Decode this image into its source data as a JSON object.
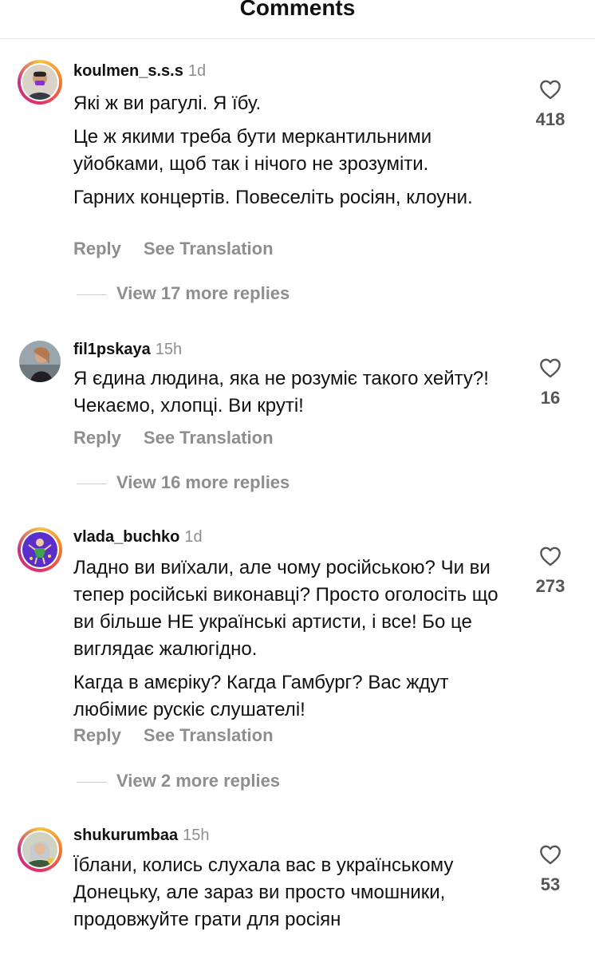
{
  "header": {
    "title": "Comments"
  },
  "comments": [
    {
      "username": "koulmen_s.s.s",
      "time": "1d",
      "paragraphs": [
        "Які ж ви рагулі. Я їбу.",
        "Це ж якими треба бути меркантильними уйобками, щоб так і нічого не зрозуміти.",
        "Гарних концертів. Повеселіть росіян, клоуни."
      ],
      "likes": "418",
      "reply": "Reply",
      "translate": "See Translation",
      "view_replies": "View 17 more replies"
    },
    {
      "username": "fil1pskaya",
      "time": "15h",
      "paragraphs": [
        "Я єдина людина, яка не розуміє такого хейту?! Чекаємо, хлопці. Ви круті!"
      ],
      "likes": "16",
      "reply": "Reply",
      "translate": "See Translation",
      "view_replies": "View 16 more replies"
    },
    {
      "username": "vlada_buchko",
      "time": "1d",
      "paragraphs": [
        "Ладно ви виїхали, але чому російською? Чи ви тепер російські виконавці? Просто оголосіть що ви більше НЕ українські артисти, і все! Бо це виглядає жалюгідно.",
        "Кагда в амєріку? Кагда Гамбург? Вас ждут любімиє рускіє слушателі!"
      ],
      "likes": "273",
      "reply": "Reply",
      "translate": "See Translation",
      "view_replies": "View 2 more replies"
    },
    {
      "username": "shukurumbaa",
      "time": "15h",
      "paragraphs": [
        "Їблани, колись слухала вас в українському Донецьку, але зараз ви просто чмошники, продовжуйте грати для росіян"
      ],
      "likes": "53"
    }
  ],
  "icons": {
    "like": "heart-outline-icon"
  },
  "colors": {
    "text": "#111111",
    "muted": "#8e8e8e",
    "story_ring": "#e1306c"
  }
}
